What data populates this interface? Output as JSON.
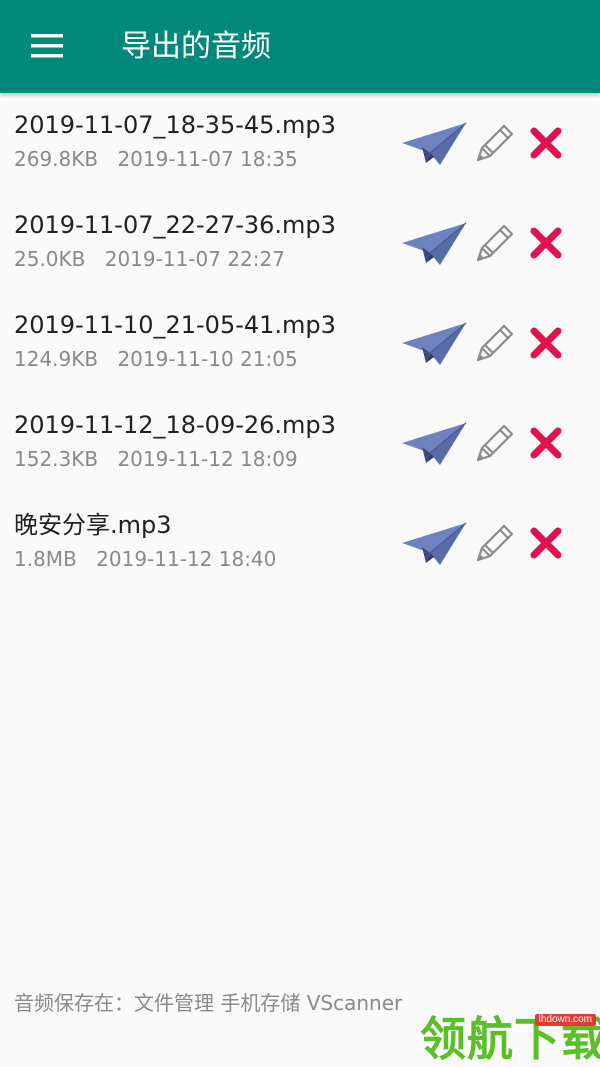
{
  "colors": {
    "toolbar_bg": "#00897b",
    "title_text": "#ffffff",
    "share_icon": "#6f82c0",
    "delete_icon": "#e0134e",
    "meta_text": "#8a8a8a"
  },
  "toolbar": {
    "menu_icon": "hamburger-menu-icon",
    "title": "导出的音频"
  },
  "files": [
    {
      "name": "2019-11-07_18-35-45.mp3",
      "size": "269.8KB",
      "date": "2019-11-07 18:35"
    },
    {
      "name": "2019-11-07_22-27-36.mp3",
      "size": "25.0KB",
      "date": "2019-11-07 22:27"
    },
    {
      "name": "2019-11-10_21-05-41.mp3",
      "size": "124.9KB",
      "date": "2019-11-10 21:05"
    },
    {
      "name": "2019-11-12_18-09-26.mp3",
      "size": "152.3KB",
      "date": "2019-11-12 18:09"
    },
    {
      "name": "晚安分享.mp3",
      "size": "1.8MB",
      "date": "2019-11-12 18:40"
    }
  ],
  "actions": {
    "share_icon": "paper-plane-icon",
    "edit_icon": "pencil-icon",
    "delete_icon": "close-x-icon"
  },
  "footer": {
    "note": "音频保存在：文件管理 手机存储 VScanner"
  },
  "watermark": {
    "text": "领航下载",
    "url": "lhdown.com"
  }
}
